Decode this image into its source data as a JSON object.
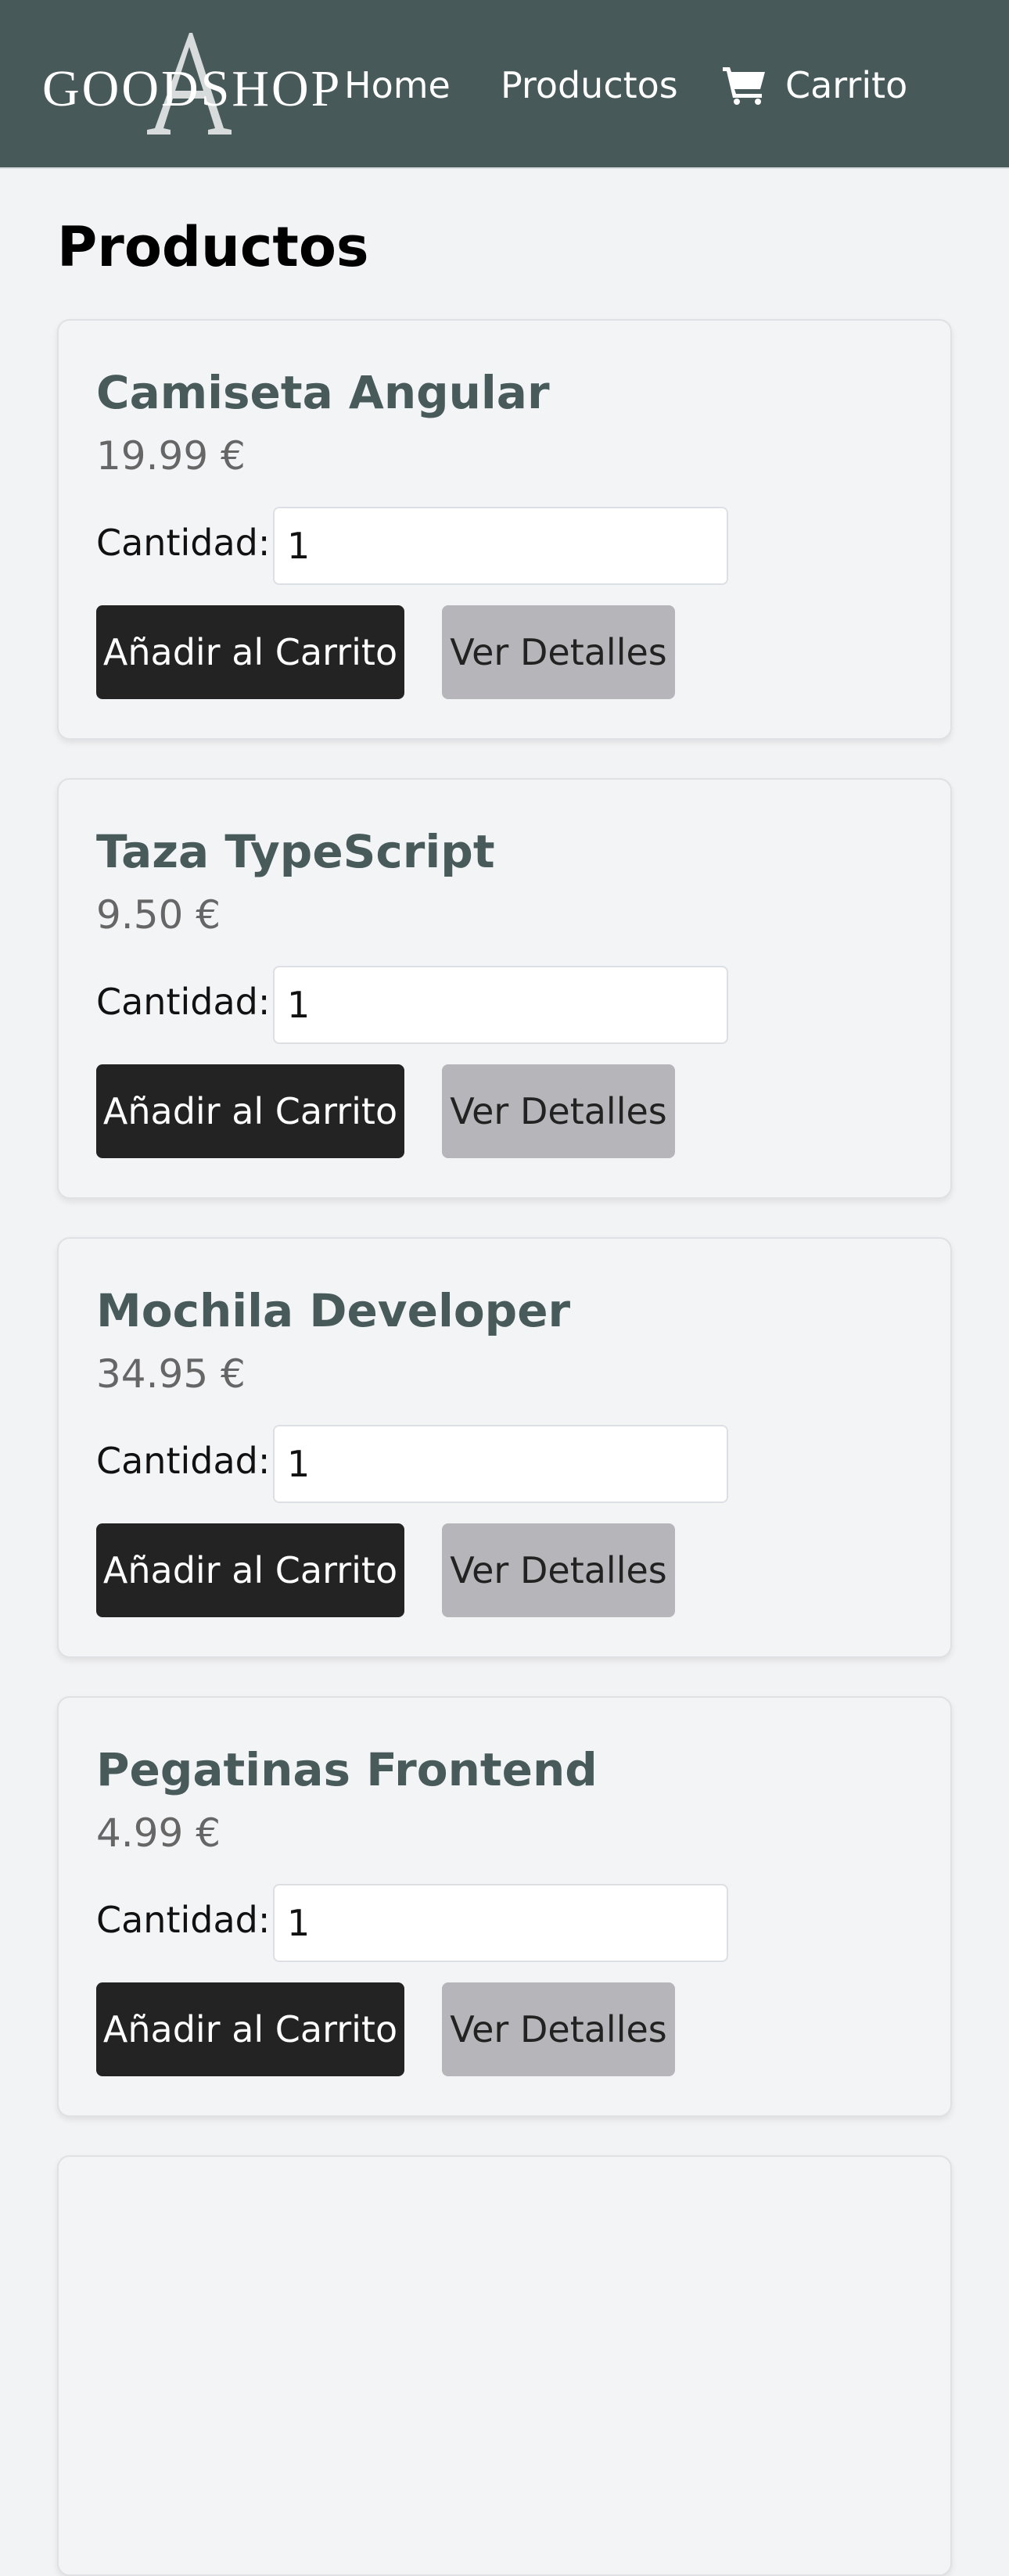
{
  "header": {
    "logo_text": "GOODSHOP",
    "logo_letter": "A",
    "nav": [
      {
        "label": "Home"
      },
      {
        "label": "Productos"
      },
      {
        "label": "Carrito",
        "icon": "cart-icon"
      }
    ]
  },
  "main": {
    "title": "Productos",
    "products": [
      {
        "name": "Camiseta Angular",
        "price": "19.99 €",
        "qty_label": "Cantidad:",
        "qty": "1",
        "add_label": "Añadir al Carrito",
        "details_label": "Ver Detalles"
      },
      {
        "name": "Taza TypeScript",
        "price": "9.50 €",
        "qty_label": "Cantidad:",
        "qty": "1",
        "add_label": "Añadir al Carrito",
        "details_label": "Ver Detalles"
      },
      {
        "name": "Mochila Developer",
        "price": "34.95 €",
        "qty_label": "Cantidad:",
        "qty": "1",
        "add_label": "Añadir al Carrito",
        "details_label": "Ver Detalles"
      },
      {
        "name": "Pegatinas Frontend",
        "price": "4.99 €",
        "qty_label": "Cantidad:",
        "qty": "1",
        "add_label": "Añadir al Carrito",
        "details_label": "Ver Detalles"
      }
    ]
  },
  "colors": {
    "navbar": "#475a59",
    "product_name": "#485a59",
    "primary_button": "#232323",
    "secondary_button": "#b6b6ba",
    "page_background": "#f2f3f5"
  }
}
